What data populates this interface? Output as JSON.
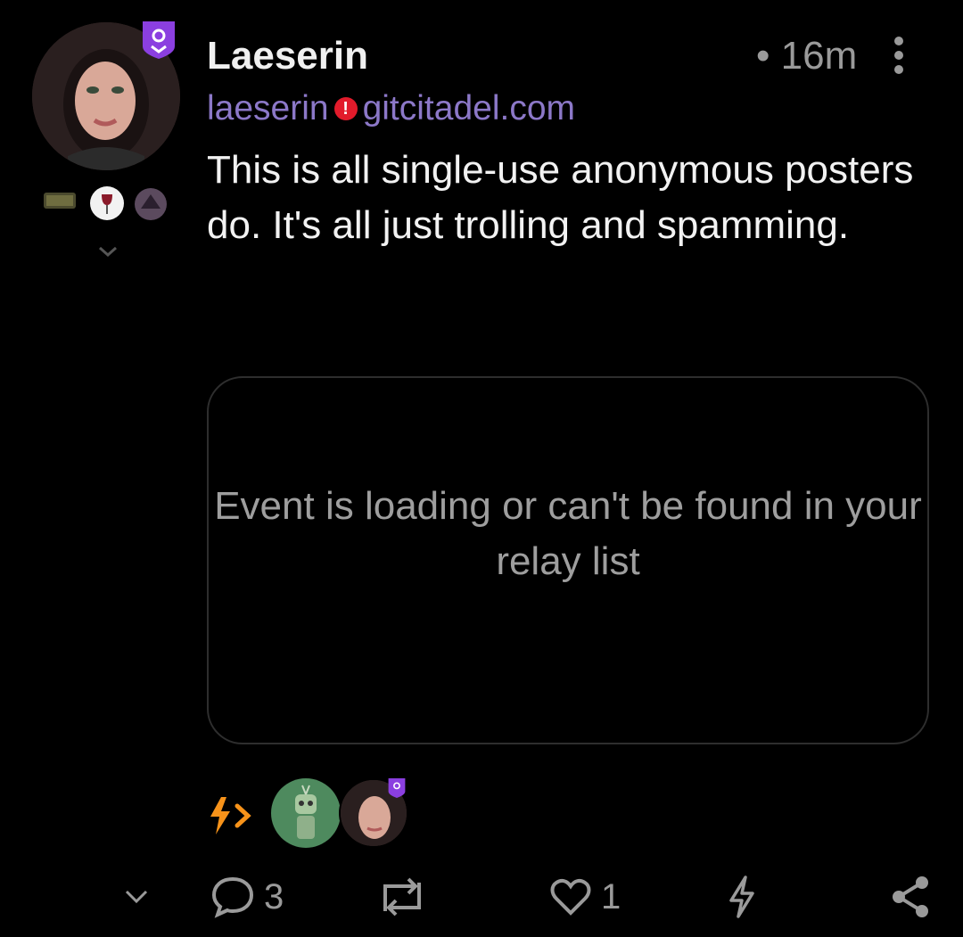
{
  "post": {
    "author_name": "Laeserin",
    "nip05_user": "laeserin",
    "nip05_domain": "gitcitadel.com",
    "time": "• 16m",
    "content": "This is all single-use anonymous posters do. It's all just trolling and spamming.",
    "embedded_event_message": "Event is loading or can't be found in your relay list"
  },
  "actions": {
    "replies": "3",
    "likes": "1"
  },
  "colors": {
    "background": "#000000",
    "nip05": "#8c78c8",
    "badge": "#8b3fe0",
    "zap": "#f7931a",
    "muted": "#9a9a9a",
    "warning": "#e21b2b"
  },
  "icons": [
    "purple-shield-badge-icon",
    "more-vertical-icon",
    "chevron-down-icon",
    "zap-icon",
    "reply-icon",
    "repost-icon",
    "heart-icon",
    "lightning-icon",
    "share-icon"
  ]
}
